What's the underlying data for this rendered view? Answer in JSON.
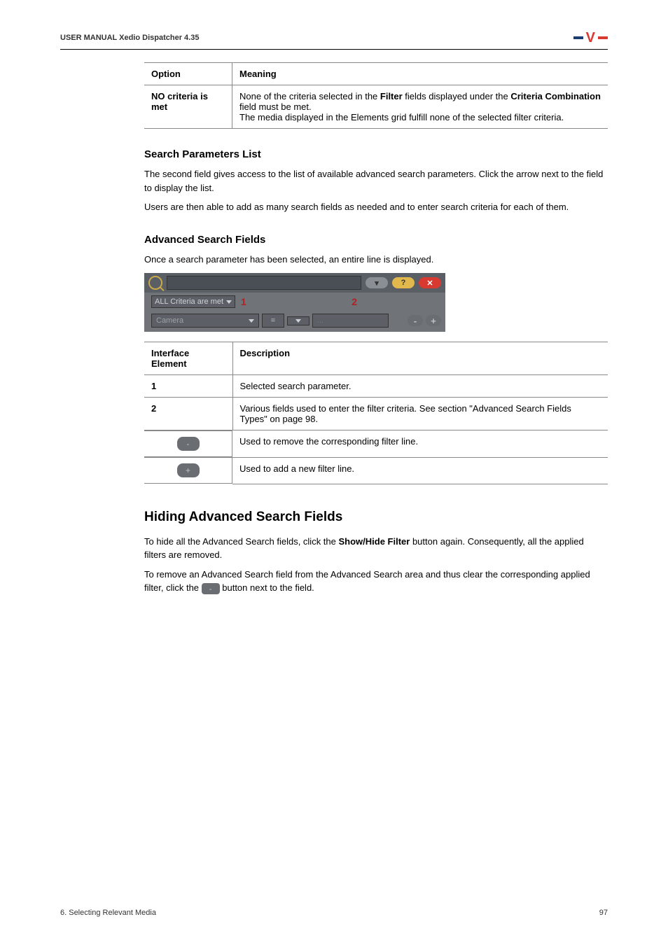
{
  "header": {
    "manual": "USER MANUAL Xedio Dispatcher 4.35"
  },
  "table1": {
    "h1": "Option",
    "h2": "Meaning",
    "r1c1": "NO criteria is met",
    "r1c2a": "None of the criteria selected in the ",
    "r1c2b": "Filter",
    "r1c2c": " fields displayed under the ",
    "r1c2d": "Criteria Combination",
    "r1c2e": " field must be met.",
    "r1c2f": "The media displayed in the Elements grid fulfill none of the selected filter criteria."
  },
  "spl": {
    "heading": "Search Parameters List",
    "p1": "The second field gives access to the list of available advanced search parameters. Click the arrow next to the field to display the list.",
    "p2": "Users are then able to add as many search fields as needed and to enter search criteria for each of them."
  },
  "asf": {
    "heading": "Advanced Search Fields",
    "p1": "Once a search parameter has been selected, an entire line is displayed."
  },
  "screenshot": {
    "criteria_label": "ALL Criteria are met",
    "num1": "1",
    "num2": "2",
    "field_name": "Camera",
    "eq": "=",
    "dots": "...",
    "minus": "-",
    "plus": "+",
    "pill_drop": "▾",
    "pill_q": "?",
    "pill_x": "✕"
  },
  "table2": {
    "h1": "Interface Element",
    "h2": "Description",
    "r1c1": "1",
    "r1c2": "Selected search parameter.",
    "r2c1": "2",
    "r2c2": "Various fields used to enter the filter criteria. See section \"Advanced Search Fields Types\" on page 98.",
    "r3_btn": "-",
    "r3c2": "Used to remove the corresponding filter line.",
    "r4_btn": "+",
    "r4c2": "Used to add a new filter line."
  },
  "hiding": {
    "heading": "Hiding Advanced Search Fields",
    "p1a": "To hide all the Advanced Search fields, click the ",
    "p1b": "Show/Hide Filter",
    "p1c": " button again. Consequently, all the applied filters are removed.",
    "p2a": "To remove an Advanced Search field from the Advanced Search area and thus clear the corresponding applied filter, click the ",
    "p2b": " button next to the field.",
    "inline_btn": "-"
  },
  "footer": {
    "left": "6. Selecting Relevant Media",
    "right": "97"
  }
}
